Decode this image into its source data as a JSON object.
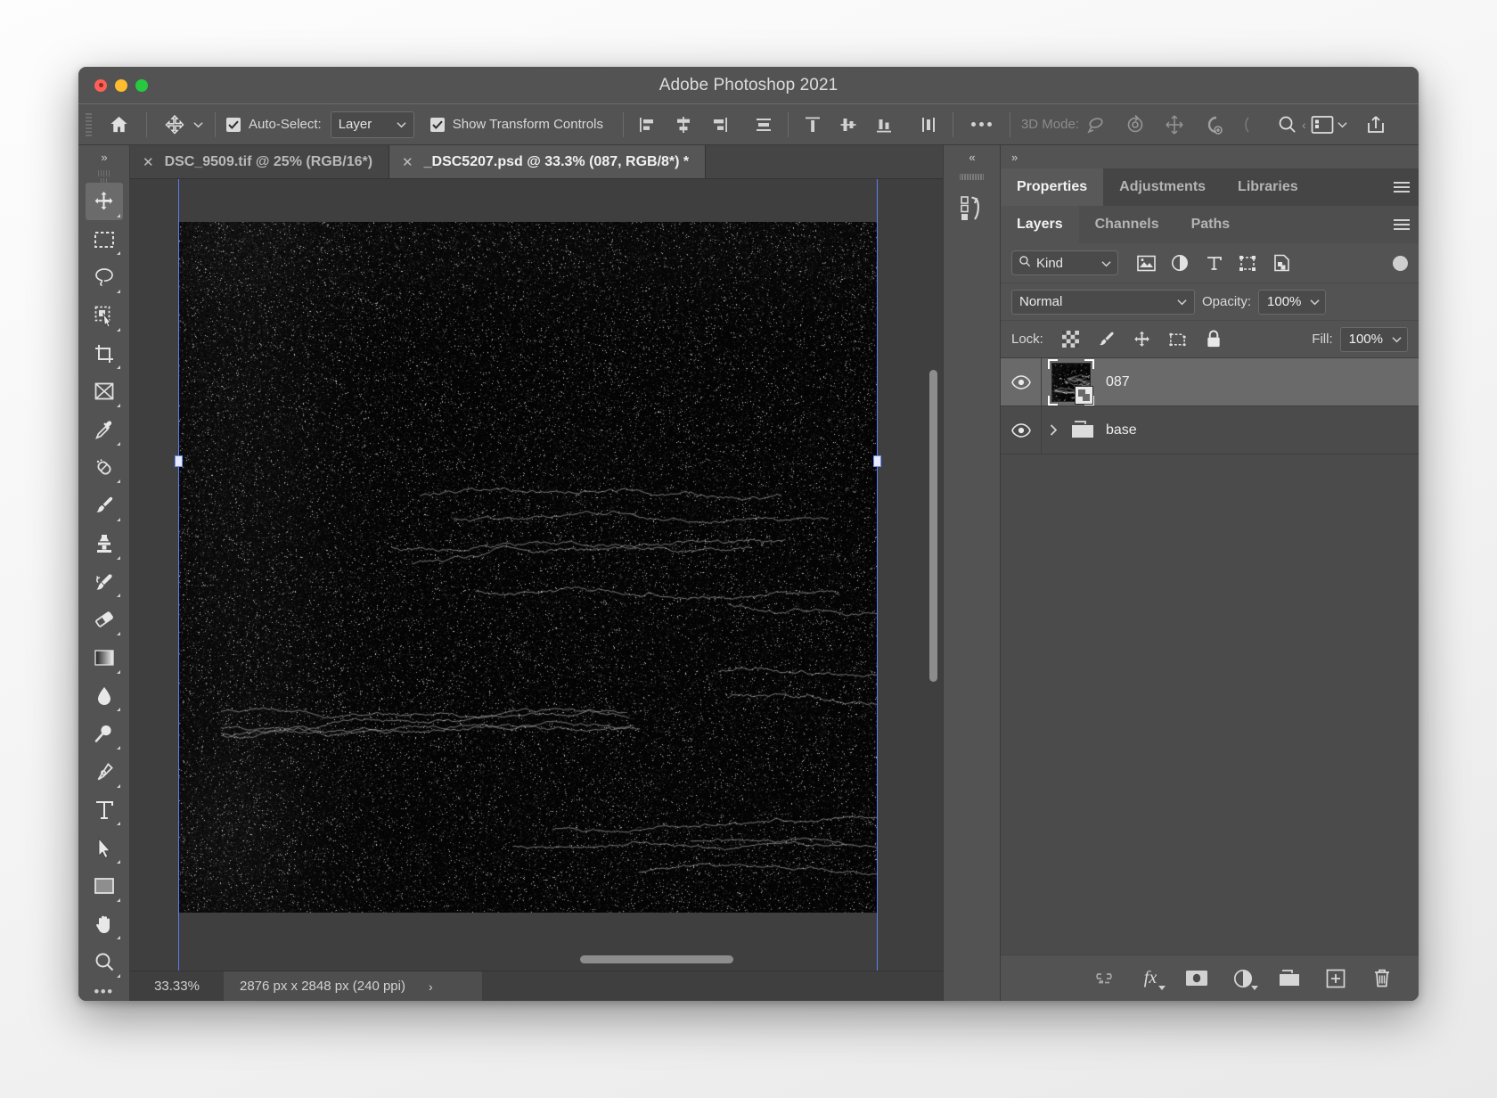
{
  "window": {
    "title": "Adobe Photoshop 2021",
    "traffic_lights": [
      "close-button",
      "minimize-button",
      "zoom-button"
    ]
  },
  "options_bar": {
    "home_icon": "home-icon",
    "tool_icon": "move-tool-icon",
    "tool_chevron": "chevron-down-icon",
    "auto_select": {
      "label": "Auto-Select:",
      "checked": true,
      "value": "Layer"
    },
    "show_transform": {
      "label": "Show Transform Controls",
      "checked": true
    },
    "align_icons": [
      "align-left-edges-icon",
      "align-horizontal-centers-icon",
      "align-right-edges-icon",
      "distribute-horizontal-icon"
    ],
    "distribute_icons": [
      "align-top-edges-icon",
      "align-vertical-centers-icon",
      "align-bottom-edges-icon",
      "distribute-vertical-icon"
    ],
    "more_icon": "ellipsis-icon",
    "mode_3d_label": "3D Mode:",
    "mode_3d_icons": [
      "orbit-3d-icon",
      "roll-3d-icon",
      "pan-3d-icon",
      "slide-3d-icon",
      "scale-3d-icon"
    ],
    "search_icon": "search-icon",
    "workspace_icon": "workspace-icon",
    "workspace_chevron": "chevron-down-icon",
    "share_icon": "share-upload-icon"
  },
  "left_toolbar": {
    "collapse_label": "»",
    "tools": [
      {
        "name": "move-tool",
        "icon": "move-arrows-icon",
        "active": true
      },
      {
        "name": "rectangular-marquee-tool",
        "icon": "marquee-rect-icon",
        "active": false
      },
      {
        "name": "lasso-tool",
        "icon": "lasso-icon",
        "active": false
      },
      {
        "name": "object-selection-tool",
        "icon": "object-select-icon",
        "active": false
      },
      {
        "name": "crop-tool",
        "icon": "crop-icon",
        "active": false
      },
      {
        "name": "frame-tool",
        "icon": "frame-icon",
        "active": false
      },
      {
        "name": "eyedropper-tool",
        "icon": "eyedropper-icon",
        "active": false
      },
      {
        "name": "spot-healing-brush-tool",
        "icon": "healing-brush-icon",
        "active": false
      },
      {
        "name": "brush-tool",
        "icon": "brush-icon",
        "active": false
      },
      {
        "name": "clone-stamp-tool",
        "icon": "clone-stamp-icon",
        "active": false
      },
      {
        "name": "history-brush-tool",
        "icon": "history-brush-icon",
        "active": false
      },
      {
        "name": "eraser-tool",
        "icon": "eraser-icon",
        "active": false
      },
      {
        "name": "gradient-tool",
        "icon": "gradient-icon",
        "active": false
      },
      {
        "name": "blur-tool",
        "icon": "blur-drop-icon",
        "active": false
      },
      {
        "name": "dodge-tool",
        "icon": "dodge-icon",
        "active": false
      },
      {
        "name": "pen-tool",
        "icon": "pen-icon",
        "active": false
      },
      {
        "name": "type-tool",
        "icon": "type-t-icon",
        "active": false
      },
      {
        "name": "path-selection-tool",
        "icon": "path-arrow-icon",
        "active": false
      },
      {
        "name": "rectangle-tool",
        "icon": "rectangle-shape-icon",
        "active": false
      },
      {
        "name": "hand-tool",
        "icon": "hand-icon",
        "active": false
      },
      {
        "name": "zoom-tool",
        "icon": "magnifier-icon",
        "active": false
      }
    ],
    "more_label": "•••"
  },
  "document_tabs": [
    {
      "label": "DSC_9509.tif @ 25% (RGB/16*)",
      "active": false,
      "close_icon": "close-icon"
    },
    {
      "label": "_DSC5207.psd @ 33.3% (087, RGB/8*) *",
      "active": true,
      "close_icon": "close-icon"
    }
  ],
  "status_bar": {
    "zoom": "33.33%",
    "dimensions": "2876 px x 2848 px (240 ppi)",
    "expand_icon": "chevron-right-icon"
  },
  "right_rail": {
    "collapse_label": "«",
    "icon": "history-panel-icon"
  },
  "panels": {
    "collapse_label": "»",
    "top_tabs": [
      {
        "label": "Properties",
        "active": true
      },
      {
        "label": "Adjustments",
        "active": false
      },
      {
        "label": "Libraries",
        "active": false
      }
    ],
    "top_menu_icon": "panel-menu-icon",
    "layer_tabs": [
      {
        "label": "Layers",
        "active": true
      },
      {
        "label": "Channels",
        "active": false
      },
      {
        "label": "Paths",
        "active": false
      }
    ],
    "layers_menu_icon": "panel-menu-icon",
    "filter": {
      "search_icon": "search-icon",
      "kind_label": "Kind",
      "chevron": "chevron-down-icon",
      "filter_icons": [
        "pixel-layer-filter-icon",
        "adjustment-layer-filter-icon",
        "type-layer-filter-icon",
        "shape-layer-filter-icon",
        "smart-object-filter-icon"
      ],
      "toggle_icon": "filter-toggle-icon"
    },
    "blend": {
      "mode": "Normal",
      "mode_chevron": "chevron-down-icon",
      "opacity_label": "Opacity:",
      "opacity_value": "100%",
      "opacity_chevron": "chevron-down-icon"
    },
    "lock": {
      "label": "Lock:",
      "icons": [
        "lock-transparent-pixels-icon",
        "lock-image-pixels-icon",
        "lock-position-icon",
        "lock-artboard-nesting-icon",
        "lock-all-icon"
      ],
      "fill_label": "Fill:",
      "fill_value": "100%",
      "fill_chevron": "chevron-down-icon"
    },
    "layers": [
      {
        "name": "087",
        "visible": true,
        "selected": true,
        "type": "smart-object",
        "eye_icon": "eye-icon",
        "badge_icon": "smart-object-badge-icon"
      },
      {
        "name": "base",
        "visible": true,
        "selected": false,
        "type": "group",
        "eye_icon": "eye-icon",
        "expand_icon": "chevron-right-icon",
        "folder_icon": "folder-icon"
      }
    ],
    "footer_icons": [
      "link-layers-icon",
      "add-layer-style-icon",
      "add-layer-mask-icon",
      "new-adjustment-layer-icon",
      "new-group-icon",
      "new-layer-icon",
      "delete-layer-icon"
    ],
    "footer_fx_label": "fx"
  },
  "colors": {
    "window_chrome": "#535353",
    "panel_bg": "#4b4b4b",
    "canvas_bg": "#3f3f3f",
    "guide_blue": "#5b7cf5",
    "selected_row": "#6a6a6a",
    "text_primary": "#eeeeee",
    "text_muted": "#b4b4b4"
  }
}
